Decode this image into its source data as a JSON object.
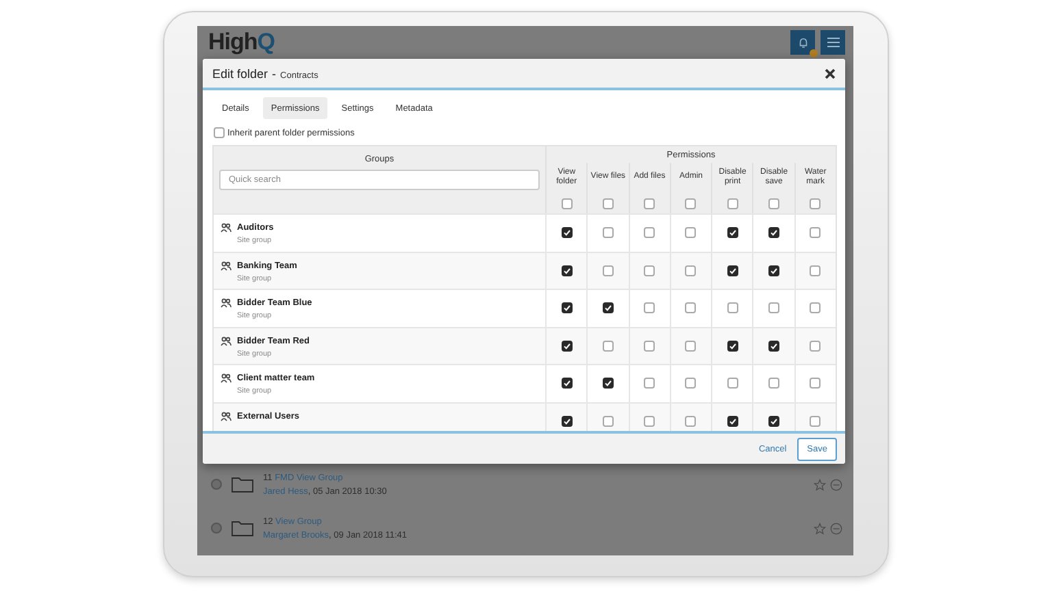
{
  "app": {
    "logo_main": "High",
    "logo_tail": "Q",
    "notifications": true
  },
  "dialog": {
    "title": "Edit folder",
    "separator": "-",
    "subtitle": "Contracts",
    "tabs": [
      {
        "label": "Details",
        "selected": false
      },
      {
        "label": "Permissions",
        "selected": true
      },
      {
        "label": "Settings",
        "selected": false
      },
      {
        "label": "Metadata",
        "selected": false
      }
    ],
    "inherit": {
      "label": "Inherit parent folder permissions",
      "checked": false
    },
    "table": {
      "groups_heading": "Groups",
      "search": {
        "placeholder": "Quick search"
      },
      "permissions_heading": "Permissions",
      "columns": [
        {
          "label": "View folder",
          "all_checked": false
        },
        {
          "label": "View files",
          "all_checked": false
        },
        {
          "label": "Add files",
          "all_checked": false
        },
        {
          "label": "Admin",
          "all_checked": false
        },
        {
          "label": "Disable print",
          "all_checked": false
        },
        {
          "label": "Disable save",
          "all_checked": false
        },
        {
          "label": "Water mark",
          "all_checked": false
        }
      ],
      "rows": [
        {
          "name": "Auditors",
          "type": "Site group",
          "checked": [
            true,
            false,
            false,
            false,
            true,
            true,
            false
          ]
        },
        {
          "name": "Banking Team",
          "type": "Site group",
          "checked": [
            true,
            false,
            false,
            false,
            true,
            true,
            false
          ]
        },
        {
          "name": "Bidder Team Blue",
          "type": "Site group",
          "checked": [
            true,
            true,
            false,
            false,
            false,
            false,
            false
          ]
        },
        {
          "name": "Bidder Team Red",
          "type": "Site group",
          "checked": [
            true,
            false,
            false,
            false,
            true,
            true,
            false
          ]
        },
        {
          "name": "Client matter team",
          "type": "Site group",
          "checked": [
            true,
            true,
            false,
            false,
            false,
            false,
            false
          ]
        },
        {
          "name": "External Users",
          "checked": [
            true,
            false,
            false,
            false,
            true,
            true,
            false
          ]
        }
      ]
    },
    "buttons": [
      {
        "label": "Cancel",
        "kind": "link"
      },
      {
        "label": "Save",
        "kind": "outlined"
      }
    ]
  },
  "list": [
    {
      "checked": false,
      "number": "11",
      "title": "FMD View Group",
      "author": "Jared Hess",
      "date": ", 05 Jan 2018 10:30"
    },
    {
      "checked": false,
      "number": "12",
      "title": "View Group",
      "author": "Margaret Brooks",
      "date": ", 09 Jan 2018 11:41"
    }
  ]
}
